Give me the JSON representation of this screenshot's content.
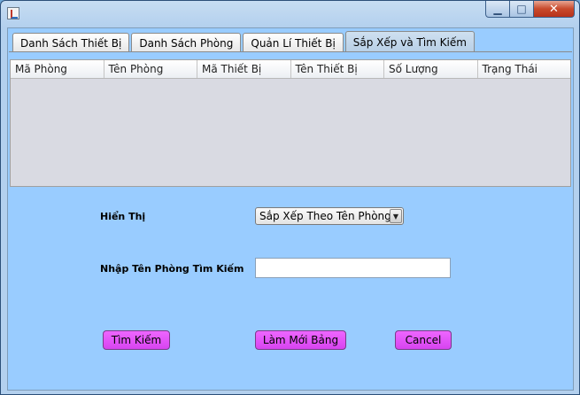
{
  "window": {
    "title": "",
    "controls": {
      "minimize": "▁",
      "maximize": "□",
      "close": "✕"
    }
  },
  "tabs": [
    {
      "label": "Danh Sách Thiết Bị",
      "active": false
    },
    {
      "label": "Danh Sách Phòng",
      "active": false
    },
    {
      "label": "Quản Lí Thiết Bị",
      "active": false
    },
    {
      "label": "Sắp Xếp và Tìm Kiếm",
      "active": true
    }
  ],
  "table": {
    "columns": [
      "Mã Phòng",
      "Tên Phòng",
      "Mã Thiết Bị",
      "Tên Thiết Bị",
      "Số Lượng",
      "Trạng Thái"
    ],
    "rows": []
  },
  "form": {
    "display_label": "Hiển Thị",
    "sort_select": {
      "selected": "Sắp Xếp Theo Tên Phòng",
      "arrow": "▼"
    },
    "search_label": "Nhập Tên Phòng Tìm Kiếm",
    "search_input": {
      "value": "",
      "placeholder": ""
    }
  },
  "buttons": {
    "search": "Tìm Kiếm",
    "refresh": "Làm Mới Bảng",
    "cancel": "Cancel"
  },
  "colors": {
    "panel_background": "#99ccff",
    "button_background": "#e055f5",
    "table_background": "#d9dae2"
  }
}
